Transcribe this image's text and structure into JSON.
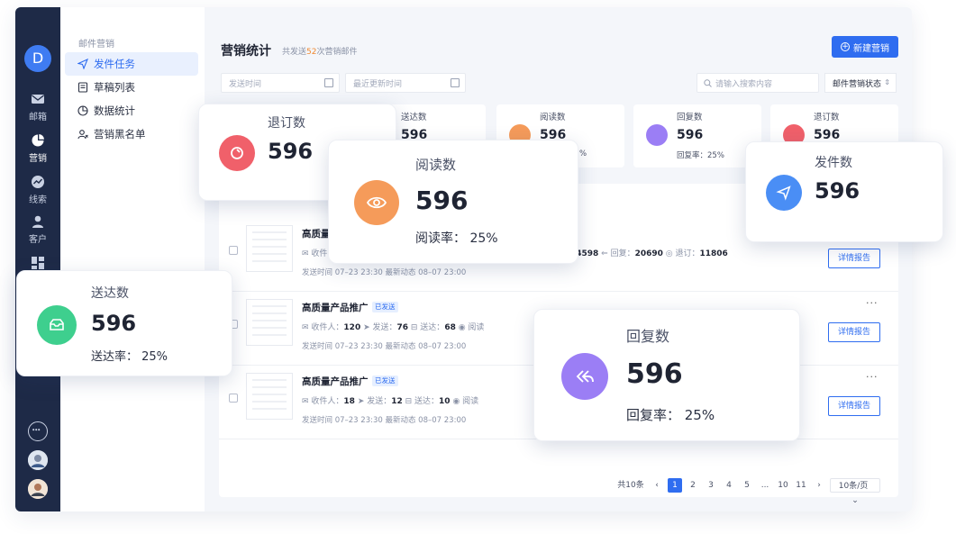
{
  "rail": {
    "logo": "D",
    "items": [
      "邮箱",
      "营销",
      "线索",
      "客户"
    ]
  },
  "side": {
    "group": "邮件营销",
    "items": [
      "发件任务",
      "草稿列表",
      "数据统计",
      "营销黑名单"
    ]
  },
  "header": {
    "title": "营销统计",
    "subtitle_pre": "共发送",
    "subtitle_count": "52",
    "subtitle_post": "次营销邮件",
    "new_button": "新建营销"
  },
  "filters": {
    "send_time": "发送时间",
    "update_time": "最近更新时间",
    "search_placeholder": "请输入搜索内容",
    "state_select": "邮件营销状态"
  },
  "stat_cards": [
    {
      "label": "送达数",
      "value": "596",
      "rate": "",
      "color": "#3ecf8e"
    },
    {
      "label": "阅读数",
      "value": "596",
      "rate": "%",
      "color": "#f59b5a"
    },
    {
      "label": "回复数",
      "value": "596",
      "rate": "回复率：25%",
      "color": "#9b7ef5"
    },
    {
      "label": "退订数",
      "value": "596",
      "rate": "",
      "color": "#f0606a"
    }
  ],
  "rows": [
    {
      "title": "高质量",
      "meta": "收件",
      "stat_send": "74598",
      "stat_reply_label": "回复：",
      "stat_reply": "20690",
      "stat_unsub_label": "退订：",
      "stat_unsub": "11806",
      "time": "发送时间 07–23 23:30   最新动态 08–07 23:00",
      "report": "详情报告"
    },
    {
      "title": "高质量产品推广",
      "badge": "已发送",
      "recv_label": "收件人：",
      "recv": "120",
      "send_label": "发送：",
      "send": "76",
      "deliver_label": "送达：",
      "deliver": "68",
      "read_label": "阅读",
      "time": "发送时间 07–23 23:30   最新动态 08–07 23:00",
      "report": "详情报告",
      "more": "···"
    },
    {
      "title": "高质量产品推广",
      "badge": "已发送",
      "recv_label": "收件人：",
      "recv": "18",
      "send_label": "发送：",
      "send": "12",
      "deliver_label": "送达：",
      "deliver": "10",
      "read_label": "阅读",
      "time": "发送时间 07–23 23:30   最新动态 08–07 23:00",
      "report": "详情报告",
      "more": "···"
    }
  ],
  "pager": {
    "total": "共10条",
    "pages": [
      "1",
      "2",
      "3",
      "4",
      "5",
      "...",
      "10",
      "11"
    ],
    "current": "1",
    "size": "10条/页"
  },
  "popups": {
    "unsub": {
      "label": "退订数",
      "value": "596",
      "color": "#f0606a"
    },
    "read": {
      "label": "阅读数",
      "value": "596",
      "rate": "阅读率：  25%",
      "color": "#f59b5a"
    },
    "send": {
      "label": "发件数",
      "value": "596",
      "color": "#4a8ef5"
    },
    "deliver": {
      "label": "送达数",
      "value": "596",
      "rate": "送达率：  25%",
      "color": "#3ecf8e"
    },
    "reply": {
      "label": "回复数",
      "value": "596",
      "rate": "回复率：  25%",
      "color": "#9b7ef5"
    }
  }
}
